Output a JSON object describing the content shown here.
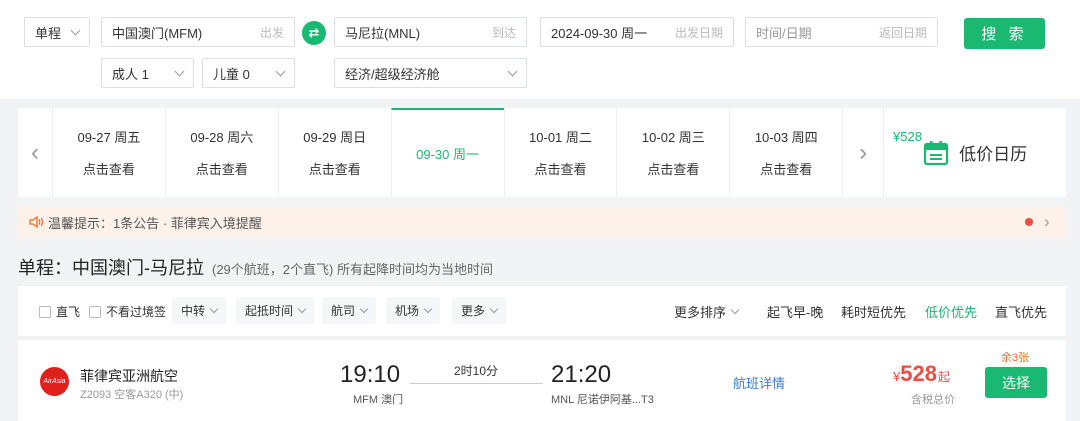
{
  "search": {
    "trip_type": "单程",
    "from_value": "中国澳门(MFM)",
    "from_hint": "出发",
    "to_value": "马尼拉(MNL)",
    "to_hint": "到达",
    "depart_date": "2024-09-30 周一",
    "depart_hint": "出发日期",
    "return_placeholder": "时间/日期",
    "return_hint": "返回日期",
    "search_label": "搜 索",
    "adults": "成人 1",
    "children": "儿童 0",
    "cabin": "经济/超级经济舱"
  },
  "date_strip": {
    "days": [
      {
        "date": "09-27 周五",
        "price": "点击查看"
      },
      {
        "date": "09-28 周六",
        "price": "点击查看"
      },
      {
        "date": "09-29 周日",
        "price": "点击查看"
      },
      {
        "date": "09-30 周一",
        "price": "¥528"
      },
      {
        "date": "10-01 周二",
        "price": "点击查看"
      },
      {
        "date": "10-02 周三",
        "price": "点击查看"
      },
      {
        "date": "10-03 周四",
        "price": "点击查看"
      }
    ],
    "calendar_label": "低价日历"
  },
  "notice": {
    "text": "温馨提示：1条公告 · 菲律宾入境提醒"
  },
  "route": {
    "title": "单程：中国澳门-马尼拉",
    "subtitle": "(29个航班，2个直飞) 所有起降时间均为当地时间"
  },
  "filters": {
    "checkboxes": [
      "直飞",
      "不看过境签"
    ],
    "dropdowns": [
      "中转",
      "起抵时间",
      "航司",
      "机场",
      "更多"
    ],
    "more_sort": "更多排序",
    "sorts": [
      "起飞早-晚",
      "耗时短优先",
      "低价优先",
      "直飞优先"
    ]
  },
  "flight": {
    "airline": "菲律宾亚洲航空",
    "logo_text": "AirAsia",
    "plane": "Z2093 空客A320 (中)",
    "dep_time": "19:10",
    "dep_port": "MFM 澳门",
    "duration": "2时10分",
    "arr_time": "21:20",
    "arr_port": "MNL 尼诺伊阿基...T3",
    "detail": "航班详情",
    "seats_left": "余3张",
    "currency": "¥",
    "price": "528",
    "price_suffix": "起",
    "tax_note": "含税总价",
    "select": "选择"
  },
  "colors": {
    "accent": "#1ab870",
    "price": "#f04d3e",
    "link": "#3a7bd5"
  }
}
